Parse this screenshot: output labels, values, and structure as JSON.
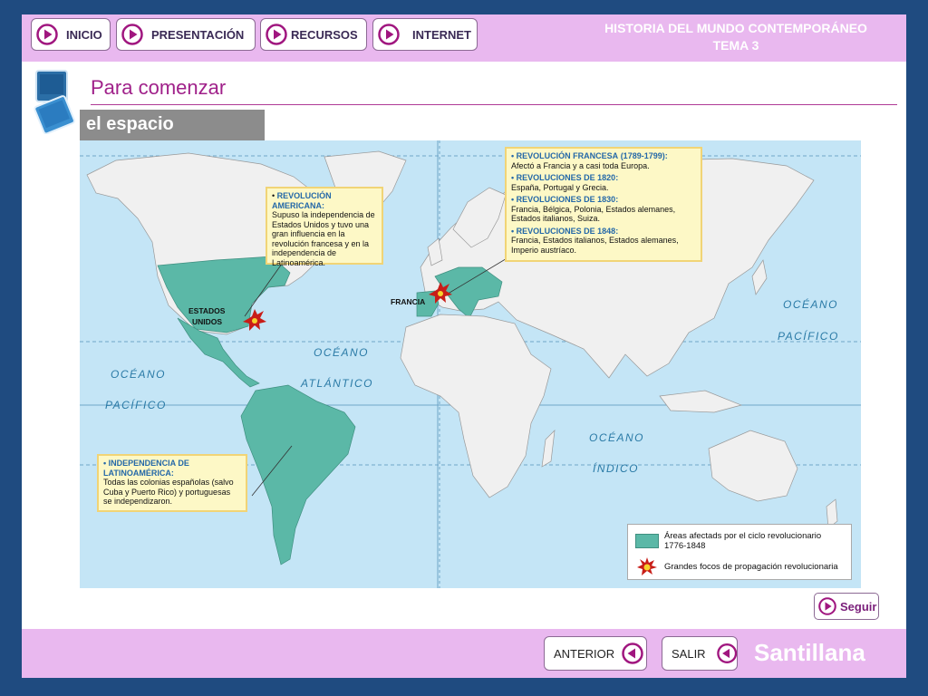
{
  "nav": {
    "inicio": "INICIO",
    "presentacion": "PRESENTACIÓN",
    "recursos": "RECURSOS",
    "internet": "INTERNET"
  },
  "header": {
    "subject": "HISTORIA DEL MUNDO CONTEMPORÁNEO",
    "topic": "TEMA 3"
  },
  "page_title": "Para comenzar",
  "section": "el espacio",
  "map": {
    "labels": {
      "estados_unidos": [
        "ESTADOS",
        "UNIDOS"
      ],
      "francia": "FRANCIA",
      "oceano_pacifico_e": [
        "OCÉANO",
        "PACÍFICO"
      ],
      "oceano_atlantico": [
        "OCÉANO",
        "ATLÁNTICO"
      ],
      "oceano_pacifico_w": [
        "OCÉANO",
        "PACÍFICO"
      ],
      "oceano_indico": [
        "OCÉANO",
        "ÍNDICO"
      ]
    },
    "box_america": {
      "heading": "REVOLUCIÓN AMERICANA:",
      "text": "Supuso la independencia de Estados Unidos y tuvo una gran influencia en la revolución francesa y en la independencia de Latinoamérica."
    },
    "box_europe": [
      {
        "heading": "REVOLUCIÓN FRANCESA",
        "dates": "(1789-1799):",
        "text": "Afectó a Francia y a casi toda Europa."
      },
      {
        "heading": "REVOLUCIONES DE 1820:",
        "dates": "",
        "text": "España, Portugal y Grecia."
      },
      {
        "heading": "REVOLUCIONES DE 1830:",
        "dates": "",
        "text": "Francia, Bélgica, Polonia, Estados alemanes, Estados italianos, Suiza."
      },
      {
        "heading": "REVOLUCIONES DE 1848:",
        "dates": "",
        "text": "Francia, Estados italianos, Estados alemanes, Imperio austríaco."
      }
    ],
    "box_latam": {
      "heading": "INDEPENDENCIA DE LATINOAMÉRICA:",
      "text": "Todas las colonias españolas (salvo Cuba y Puerto Rico) y portuguesas se independizaron."
    },
    "legend": {
      "area": "Áreas afectads por el ciclo revolucionario 1776-1848",
      "focus": "Grandes focos de propagación revolucionaria"
    },
    "colors": {
      "ocean": "#c4e5f6",
      "land": "#f0f0f0",
      "affected": "#5bb8a7",
      "grid": "#6fa6c8"
    }
  },
  "seguir": "Seguir",
  "footer": {
    "anterior": "ANTERIOR",
    "salir": "SALIR",
    "brand": "Santillana"
  }
}
